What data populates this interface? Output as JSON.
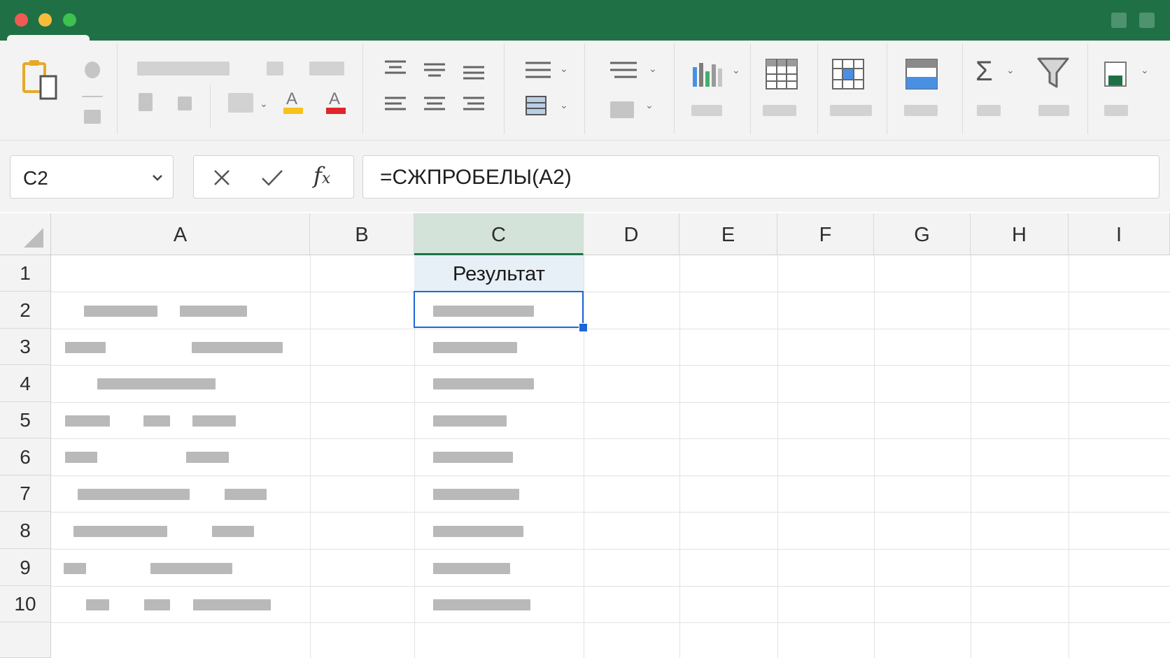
{
  "window": {
    "traffic_lights": [
      "#ee5b55",
      "#f6bd3b",
      "#3fc150"
    ],
    "accent": "#1f7145"
  },
  "ribbon": {
    "icons": [
      "paste-icon",
      "format-painter-icon",
      "fill-color-icon",
      "font-color-icon",
      "align-top-icon",
      "align-middle-icon",
      "align-bottom-icon",
      "align-left-icon",
      "align-center-icon",
      "align-right-icon",
      "wrap-text-icon",
      "merge-cells-icon",
      "number-format-icon",
      "conditional-format-icon",
      "chart-icon",
      "table-icon",
      "cell-styles-icon",
      "insert-rows-icon",
      "autosum-icon",
      "filter-icon",
      "add-ins-icon"
    ],
    "colors": {
      "highlight_bar": "#f6c21b",
      "font_color_bar": "#e0252a"
    },
    "glyphs": {
      "font_color": "A",
      "sum": "Σ"
    }
  },
  "formula_bar": {
    "name_box": "C2",
    "cancel_glyph": "✕",
    "enter_glyph": "✓",
    "fx_glyph": "f",
    "fx_sub": "x",
    "formula": "=СЖПРОБЕЛЫ(A2)"
  },
  "sheet": {
    "columns": [
      "A",
      "B",
      "C",
      "D",
      "E",
      "F",
      "G",
      "H",
      "I"
    ],
    "rows": [
      "1",
      "2",
      "3",
      "4",
      "5",
      "6",
      "7",
      "8",
      "9",
      "10"
    ],
    "selected_column": "C",
    "selected_cell": "C2",
    "c1_header": "Результат"
  }
}
